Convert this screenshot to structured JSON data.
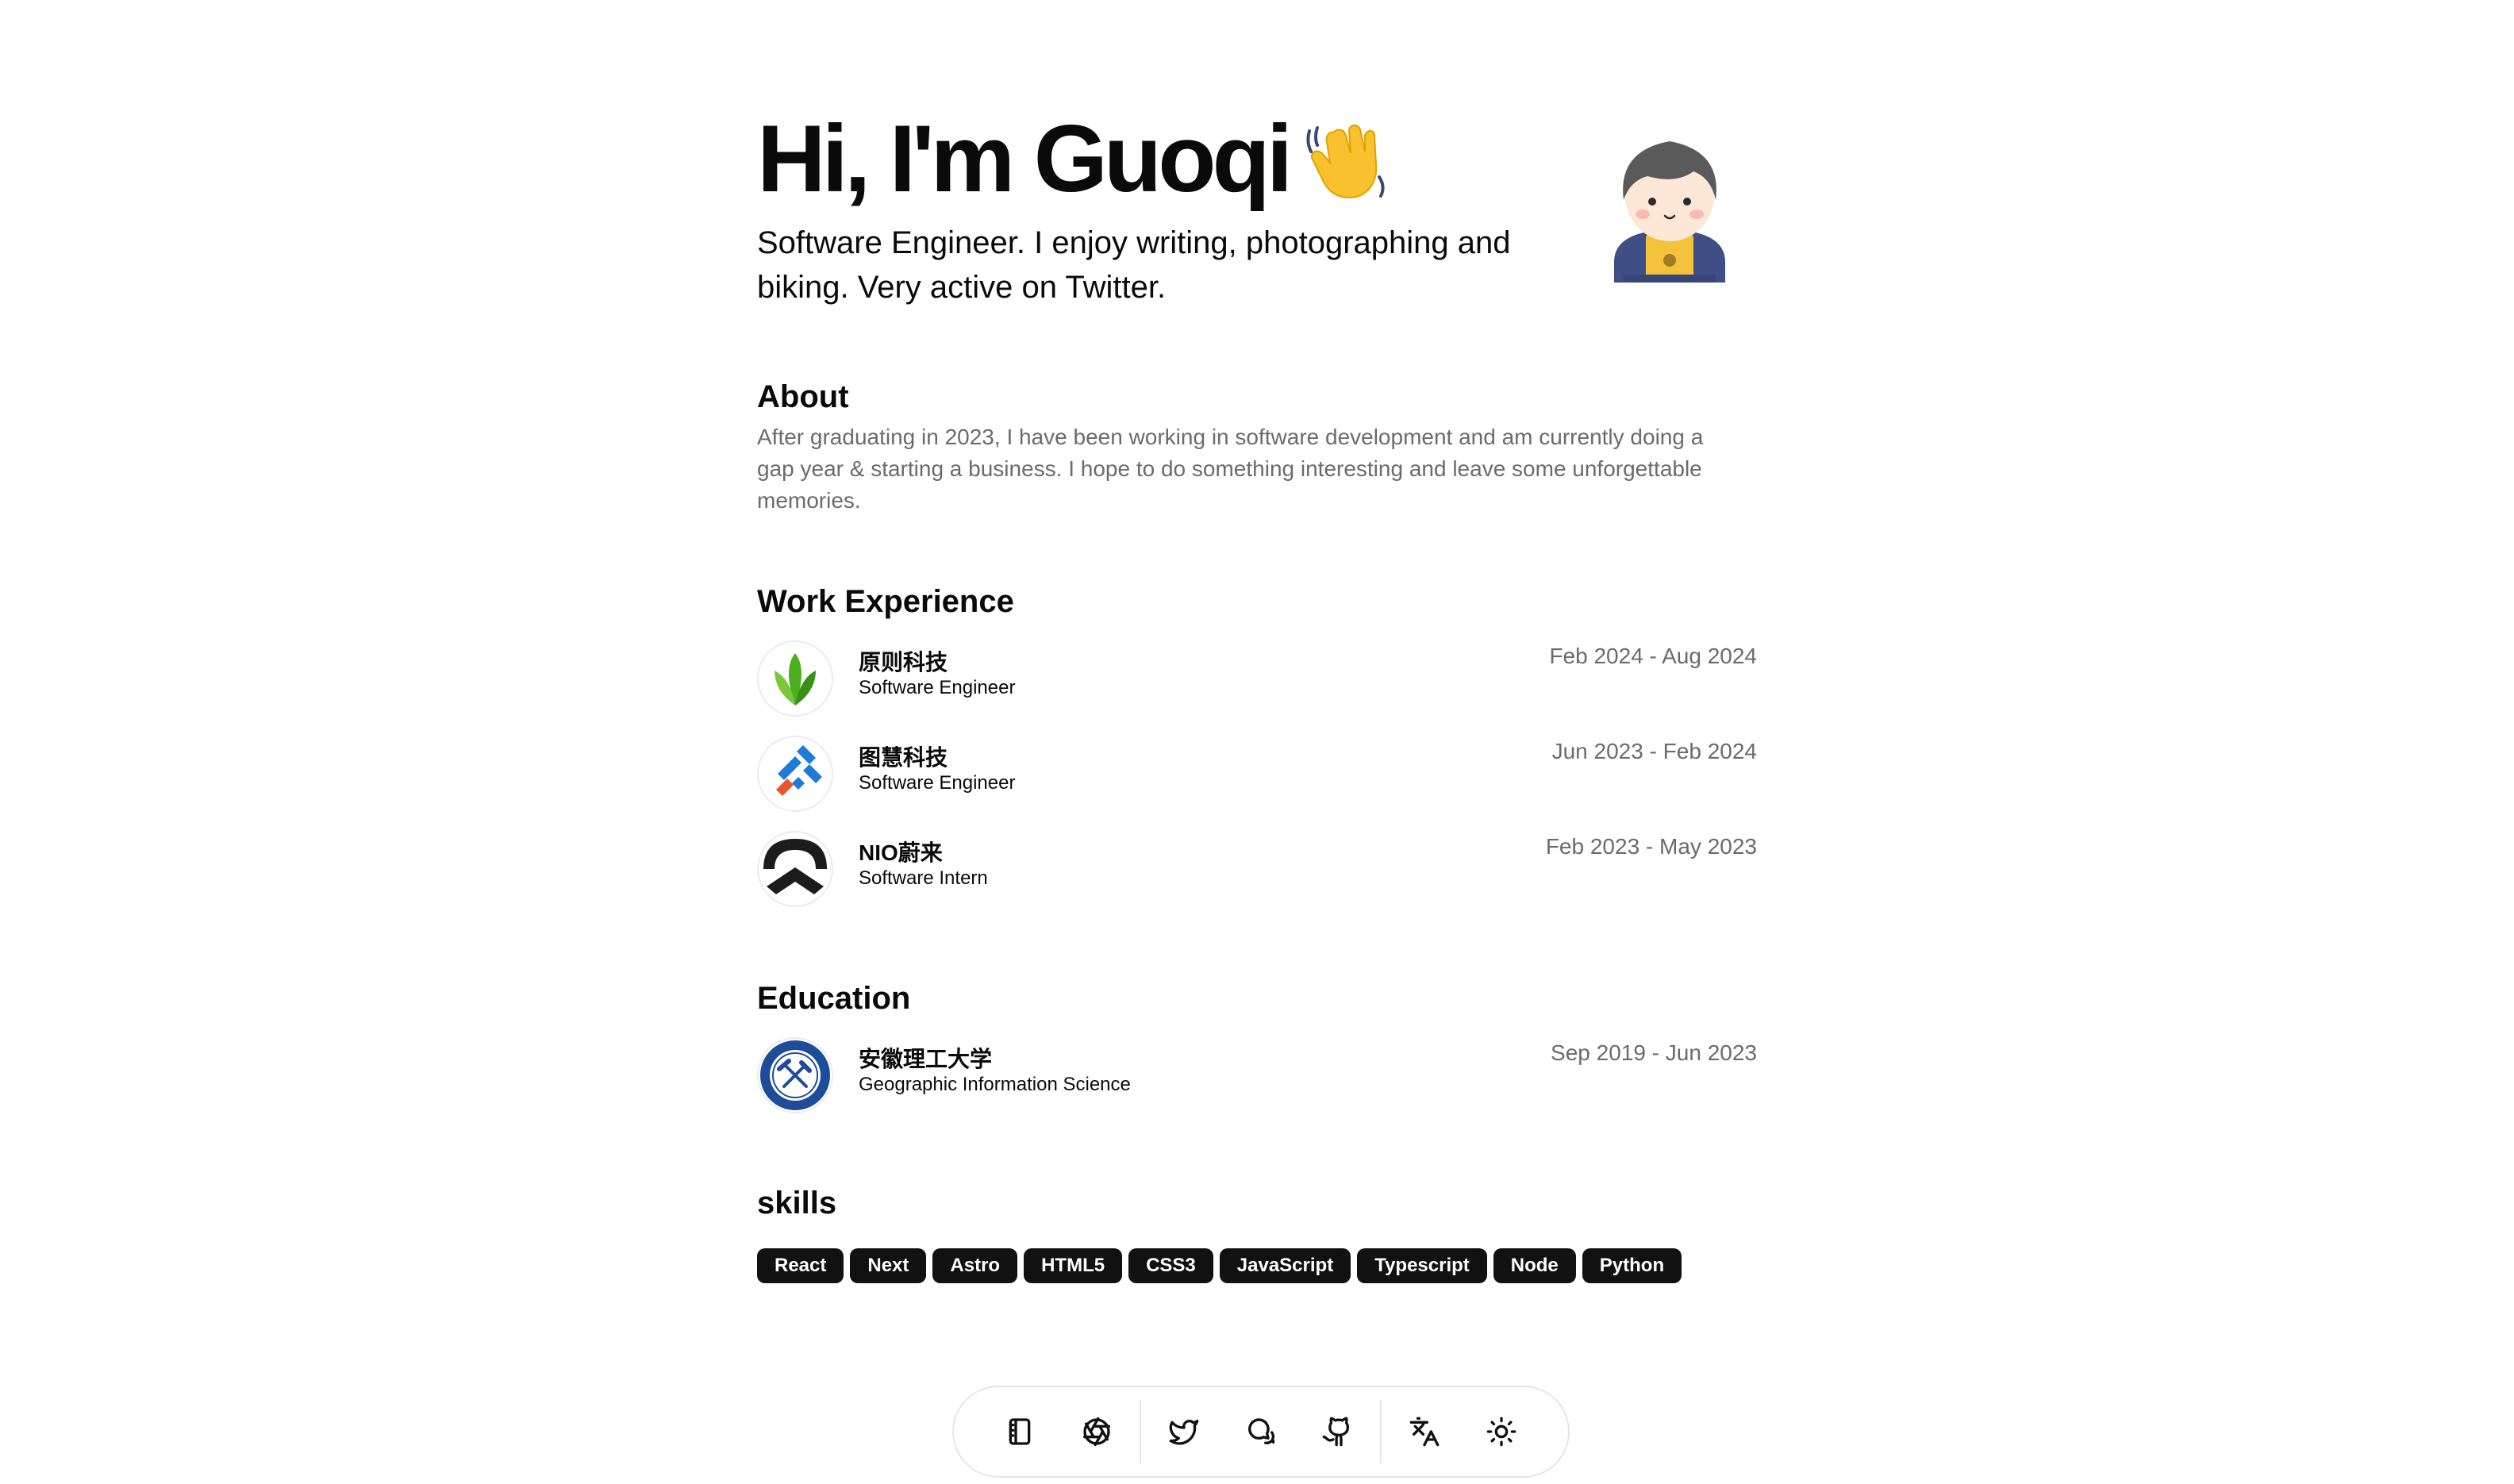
{
  "hero": {
    "title": "Hi, I'm Guoqi",
    "wave_icon": "waving-hand-emoji",
    "subtitle": "Software Engineer. I enjoy writing, photographing and biking. Very active on Twitter."
  },
  "about": {
    "heading": "About",
    "text": "After graduating in 2023, I have been working in software development and am currently doing a gap year & starting a business. I hope to do something interesting and leave some unforgettable memories."
  },
  "work": {
    "heading": "Work Experience",
    "items": [
      {
        "company": "原则科技",
        "role": "Software Engineer",
        "dates": "Feb 2024 - Aug 2024",
        "logo": "green-leaf-logo"
      },
      {
        "company": "图慧科技",
        "role": "Software Engineer",
        "dates": "Jun 2023 - Feb 2024",
        "logo": "blue-orange-logo"
      },
      {
        "company": "NIO蔚来",
        "role": "Software Intern",
        "dates": "Feb 2023 - May 2023",
        "logo": "nio-logo"
      }
    ]
  },
  "education": {
    "heading": "Education",
    "items": [
      {
        "school": "安徽理工大学",
        "major": "Geographic Information Science",
        "dates": "Sep 2019 - Jun 2023",
        "logo": "university-seal-logo"
      }
    ]
  },
  "skills": {
    "heading": "skills",
    "items": [
      "React",
      "Next",
      "Astro",
      "HTML5",
      "CSS3",
      "JavaScript",
      "Typescript",
      "Node",
      "Python"
    ]
  },
  "dock": {
    "icons": [
      "notebook-icon",
      "aperture-icon",
      "twitter-icon",
      "chat-icon",
      "github-icon",
      "translate-icon",
      "sun-icon"
    ]
  },
  "colors": {
    "text": "#0a0a0a",
    "muted": "#6b6b6b",
    "chip_bg": "#111111",
    "border": "#e6e6e6"
  }
}
